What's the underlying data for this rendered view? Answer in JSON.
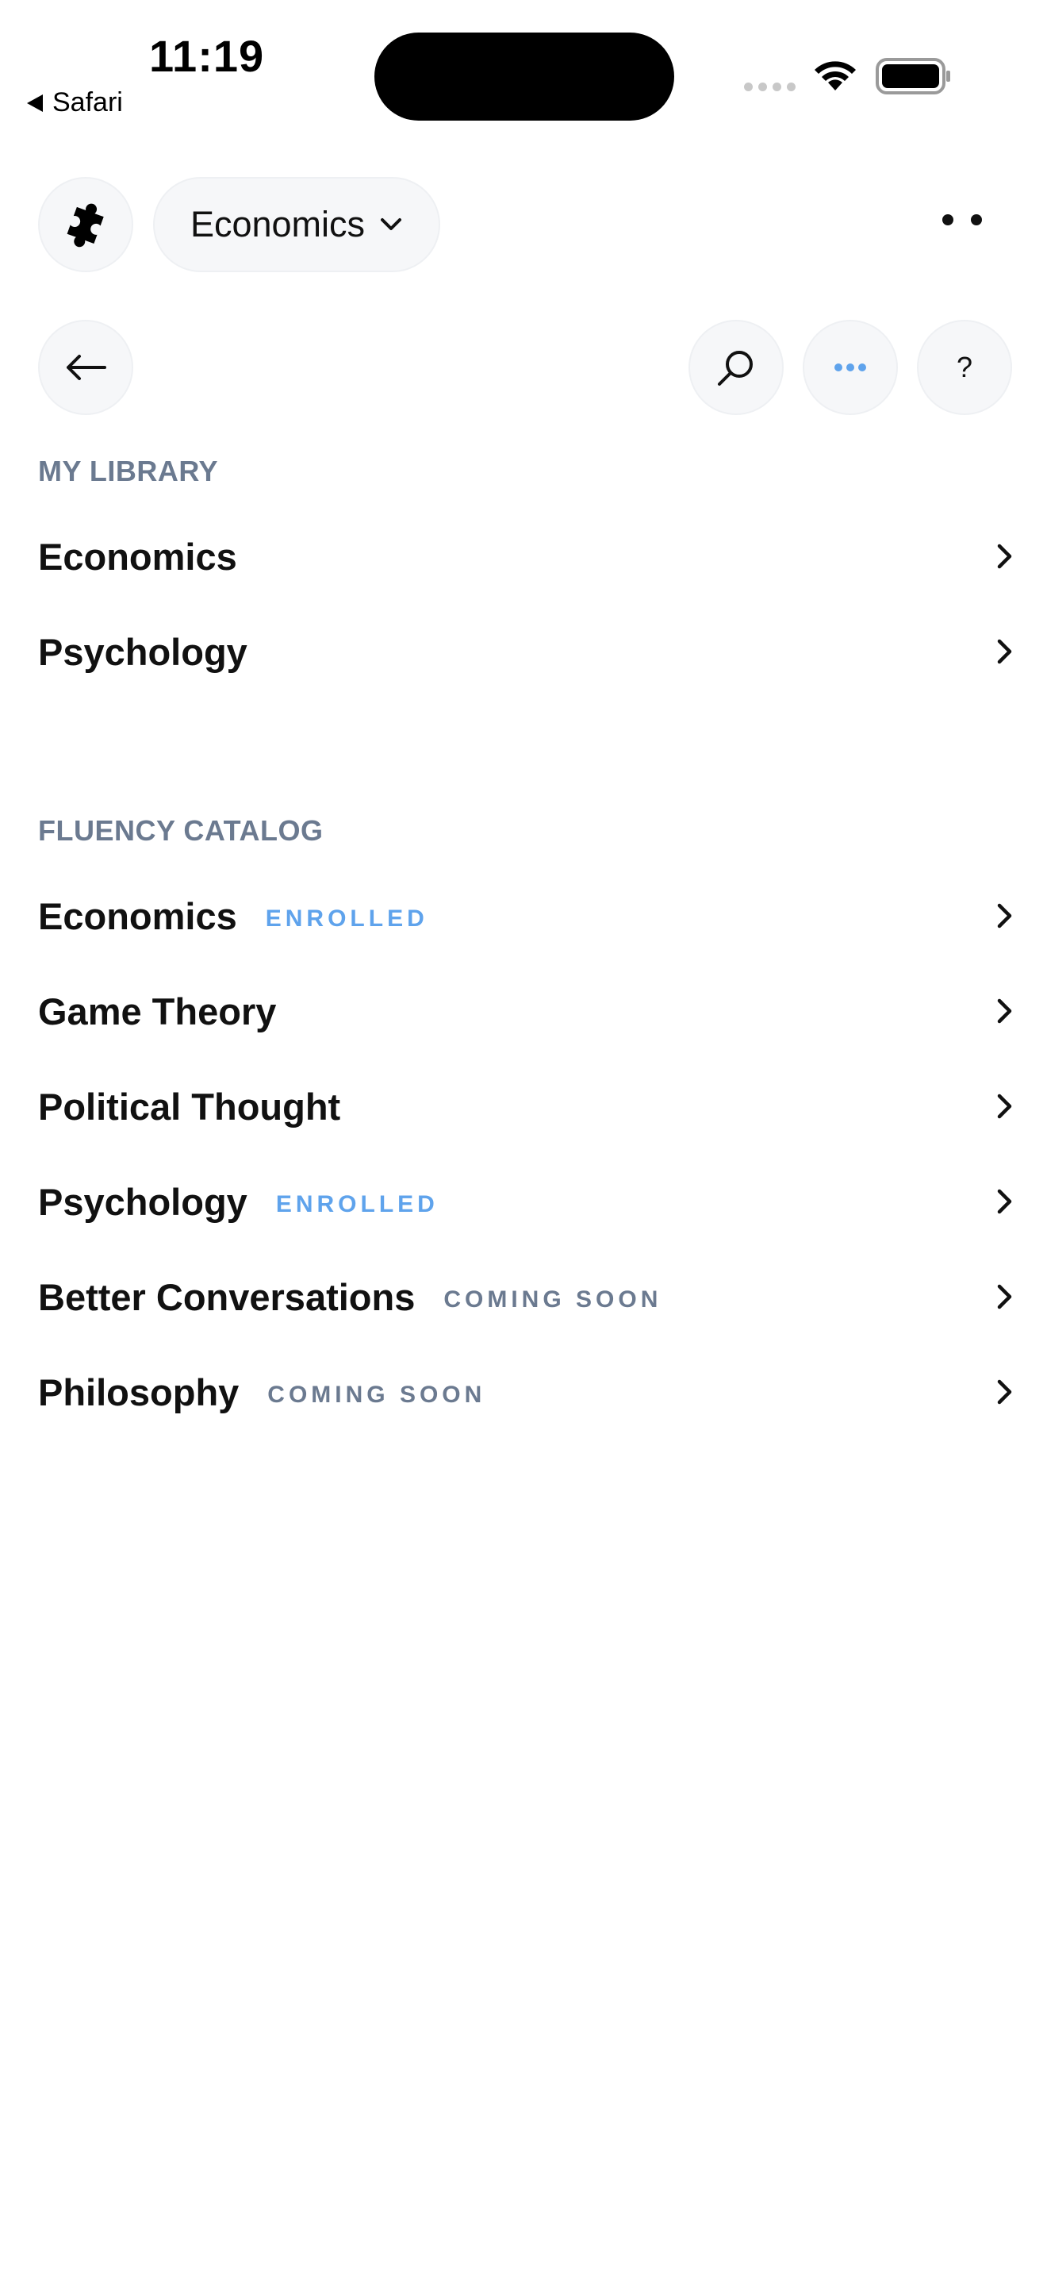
{
  "status_bar": {
    "time": "11:19",
    "back_app": "Safari"
  },
  "header": {
    "subject_selector": "Economics"
  },
  "icons": {
    "logo": "puzzle-piece-icon",
    "back": "arrow-left-icon",
    "search": "search-icon",
    "more": "ellipsis-icon",
    "help": "question-mark-icon",
    "chevron": "chevron-right-icon"
  },
  "help_label": "?",
  "colors": {
    "accent": "#5fa3ec",
    "muted": "#6b7a90",
    "button_bg": "#f6f7f9"
  },
  "library": {
    "heading": "MY LIBRARY",
    "items": [
      {
        "label": "Economics"
      },
      {
        "label": "Psychology"
      }
    ]
  },
  "catalog": {
    "heading": "FLUENCY CATALOG",
    "items": [
      {
        "label": "Economics",
        "badge": "ENROLLED"
      },
      {
        "label": "Game Theory",
        "badge": ""
      },
      {
        "label": "Political Thought",
        "badge": ""
      },
      {
        "label": "Psychology",
        "badge": "ENROLLED"
      },
      {
        "label": "Better Conversations",
        "badge": "COMING SOON"
      },
      {
        "label": "Philosophy",
        "badge": "COMING SOON"
      }
    ]
  }
}
